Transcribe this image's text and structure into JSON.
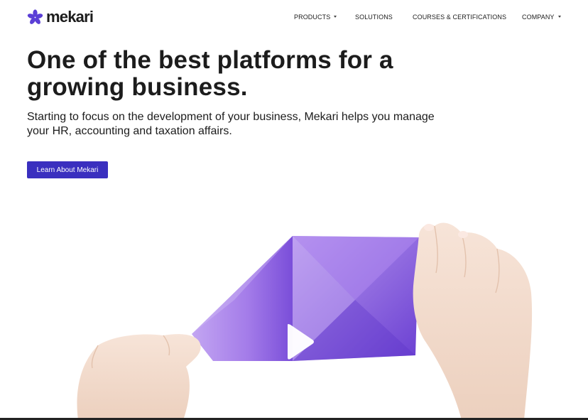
{
  "header": {
    "logo_text": "mekari",
    "nav": [
      {
        "label": "PRODUCTS",
        "has_dropdown": true
      },
      {
        "label": "SOLUTIONS",
        "has_dropdown": false
      },
      {
        "label": "COURSES & CERTIFICATIONS",
        "has_dropdown": false
      },
      {
        "label": "COMPANY",
        "has_dropdown": true
      }
    ]
  },
  "hero": {
    "headline_line1": "One of the best platforms for a",
    "headline_line2": "growing business.",
    "subtitle": "Starting to focus on the development of your business, Mekari helps you manage your HR, accounting and taxation affairs.",
    "cta_label": "Learn About Mekari"
  },
  "video": {
    "icon": "play-icon"
  },
  "colors": {
    "brand": "#3a2fbf",
    "logo_mark": "#5b3fd6",
    "text": "#1c1c1c",
    "paper": "#9a6be8"
  }
}
